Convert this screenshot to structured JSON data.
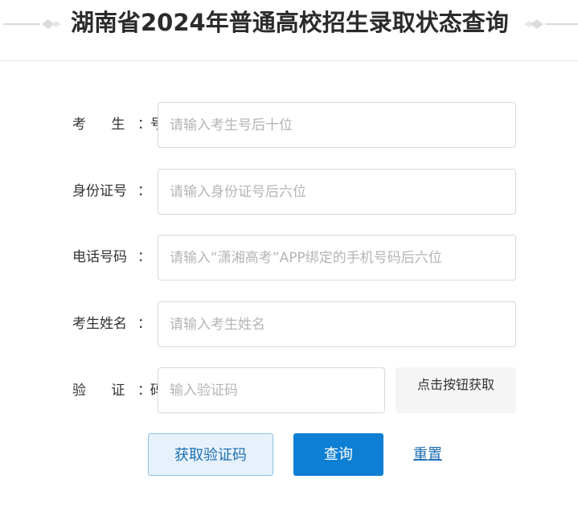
{
  "header": {
    "title": "湖南省2024年普通高校招生录取状态查询"
  },
  "form": {
    "exam_no": {
      "label": "考 生 号",
      "sep": "：",
      "placeholder": "请输入考生号后十位",
      "value": ""
    },
    "id_no": {
      "label": "身份证号",
      "sep": "：",
      "placeholder": "请输入身份证号后六位",
      "value": ""
    },
    "phone": {
      "label": "电话号码",
      "sep": "：",
      "placeholder": "请输入“潇湘高考”APP绑定的手机号码后六位",
      "value": ""
    },
    "name": {
      "label": "考生姓名",
      "sep": "：",
      "placeholder": "请输入考生姓名",
      "value": ""
    },
    "captcha": {
      "label": "验 证 码",
      "sep": "：",
      "placeholder": "输入验证码",
      "value": "",
      "image_text": "点击按钮获取"
    }
  },
  "actions": {
    "get_captcha": "获取验证码",
    "query": "查询",
    "reset": "重置"
  }
}
